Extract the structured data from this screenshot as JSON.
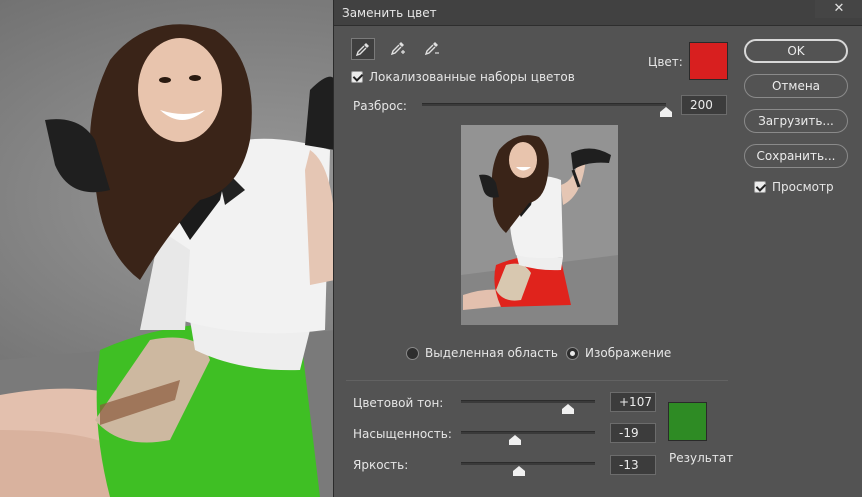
{
  "dialog": {
    "title": "Заменить цвет",
    "close_label": "✕",
    "localized_clusters_label": "Локализованные наборы цветов",
    "localized_clusters_checked": true,
    "color_label": "Цвет:",
    "color_swatch": "#d81f1f",
    "fuzziness_label": "Разброс:",
    "fuzziness_value": "200",
    "fuzziness_fraction": 1.0,
    "view_options": {
      "selection_label": "Выделенная область",
      "image_label": "Изображение",
      "selected": "image"
    },
    "hue_label": "Цветовой тон:",
    "hue_value": "+107",
    "hue_fraction": 0.797,
    "saturation_label": "Насыщенность:",
    "saturation_value": "-19",
    "saturation_fraction": 0.405,
    "lightness_label": "Яркость:",
    "lightness_value": "-13",
    "lightness_fraction": 0.435,
    "result_label": "Результат",
    "result_swatch": "#2e8b24",
    "buttons": {
      "ok": "OK",
      "cancel": "Отмена",
      "load": "Загрузить...",
      "save": "Сохранить..."
    },
    "preview_label": "Просмотр",
    "preview_checked": true,
    "tools": [
      "eyedropper-icon",
      "eyedropper-plus-icon",
      "eyedropper-minus-icon"
    ]
  },
  "colors": {
    "skirt_original": "#e0231c",
    "skirt_replaced": "#3fbf24",
    "dialog_bg": "#535353"
  }
}
